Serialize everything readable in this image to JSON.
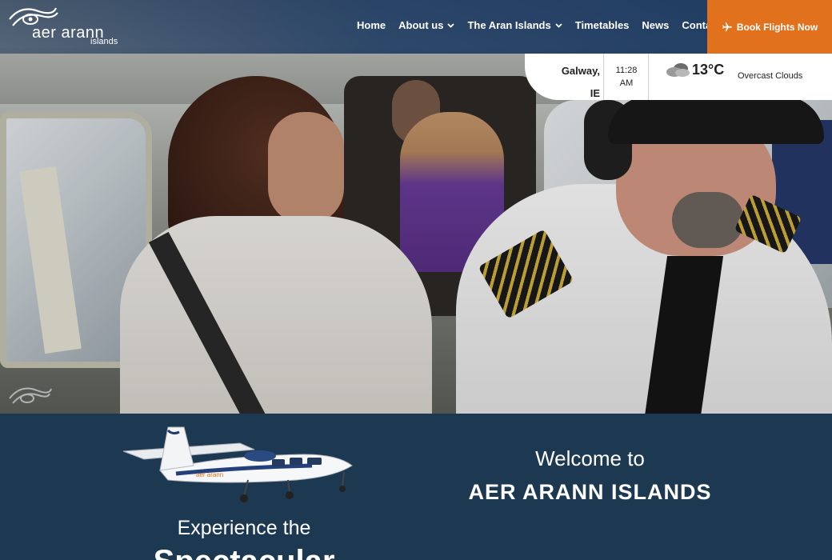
{
  "header": {
    "logo": {
      "brand": "aer arann",
      "sub": "islands"
    },
    "nav": [
      {
        "label": "Home",
        "dropdown": false
      },
      {
        "label": "About us",
        "dropdown": true
      },
      {
        "label": "The Aran Islands",
        "dropdown": true
      },
      {
        "label": "Timetables",
        "dropdown": false
      },
      {
        "label": "News",
        "dropdown": false
      },
      {
        "label": "Contact",
        "dropdown": false
      }
    ],
    "book_label": "Book Flights Now",
    "book_icon": "airplane-icon"
  },
  "weather": {
    "city": "Galway,",
    "country": "IE",
    "time": "11:28",
    "ampm": "AM",
    "temperature": "13°C",
    "description": "Overcast Clouds",
    "icon": "cloud-icon"
  },
  "intro": {
    "experience_line": "Experience the",
    "experience_line2": "Spectacular",
    "welcome_line": "Welcome to",
    "welcome_title": "AER ARANN ISLANDS"
  },
  "colors": {
    "header_bg": "#19375f",
    "book_button": "#e2711d",
    "lower_band": "#1d3952"
  }
}
